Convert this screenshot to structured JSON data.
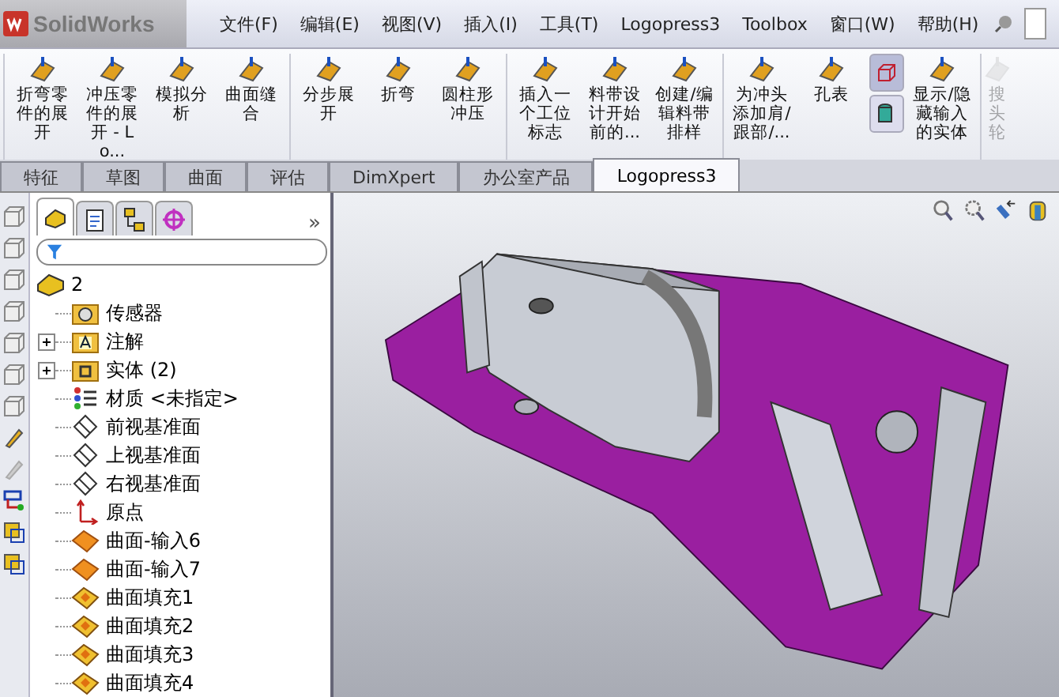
{
  "app": {
    "logo": "SolidWorks"
  },
  "menu": [
    "文件(F)",
    "编辑(E)",
    "视图(V)",
    "插入(I)",
    "工具(T)",
    "Logopress3",
    "Toolbox",
    "窗口(W)",
    "帮助(H)"
  ],
  "ribbon_groups": [
    [
      {
        "kind": "tool",
        "label": "折弯零件的展开",
        "disabled": false
      },
      {
        "kind": "tool",
        "label": "冲压零件的展开 - Lo...",
        "disabled": false
      },
      {
        "kind": "tool",
        "label": "模拟分析",
        "disabled": false
      },
      {
        "kind": "tool",
        "label": "曲面缝合",
        "disabled": false
      }
    ],
    [
      {
        "kind": "tool",
        "label": "分步展开",
        "disabled": false
      },
      {
        "kind": "tool",
        "label": "折弯",
        "disabled": false
      },
      {
        "kind": "tool",
        "label": "圆柱形冲压",
        "disabled": false
      }
    ],
    [
      {
        "kind": "tool",
        "label": "插入一个工位标志",
        "disabled": false
      },
      {
        "kind": "tool",
        "label": "料带设计开始前的...",
        "disabled": false
      },
      {
        "kind": "tool",
        "label": "创建/编辑料带排样",
        "disabled": false
      }
    ],
    [
      {
        "kind": "tool",
        "label": "为冲头添加肩/跟部/...",
        "disabled": false
      },
      {
        "kind": "tool",
        "label": "孔表",
        "disabled": false
      },
      {
        "kind": "stack"
      },
      {
        "kind": "tool",
        "label": "显示/隐藏输入的实体",
        "disabled": false
      }
    ],
    [
      {
        "kind": "tool",
        "label": "搜头轮",
        "disabled": true
      }
    ]
  ],
  "tabs": [
    {
      "label": "特征",
      "selected": false
    },
    {
      "label": "草图",
      "selected": false
    },
    {
      "label": "曲面",
      "selected": false
    },
    {
      "label": "评估",
      "selected": false
    },
    {
      "label": "DimXpert",
      "selected": false
    },
    {
      "label": "办公室产品",
      "selected": false
    },
    {
      "label": "Logopress3",
      "selected": true
    }
  ],
  "panel_tabs": [
    {
      "kind": "feature",
      "selected": true
    },
    {
      "kind": "property",
      "selected": false
    },
    {
      "kind": "config",
      "selected": false
    },
    {
      "kind": "target",
      "selected": false
    }
  ],
  "panel_more": "»",
  "tree": {
    "label": "2",
    "kind": "part",
    "children": [
      {
        "label": "传感器",
        "kind": "sensor"
      },
      {
        "label": "注解",
        "kind": "annotation",
        "expanded": false
      },
      {
        "label": "实体 (2)",
        "kind": "body",
        "expanded": false
      },
      {
        "label": "材质 <未指定>",
        "kind": "material"
      },
      {
        "label": "前视基准面",
        "kind": "plane"
      },
      {
        "label": "上视基准面",
        "kind": "plane"
      },
      {
        "label": "右视基准面",
        "kind": "plane"
      },
      {
        "label": "原点",
        "kind": "origin"
      },
      {
        "label": "曲面-输入6",
        "kind": "import"
      },
      {
        "label": "曲面-输入7",
        "kind": "import"
      },
      {
        "label": "曲面填充1",
        "kind": "fill"
      },
      {
        "label": "曲面填充2",
        "kind": "fill"
      },
      {
        "label": "曲面填充3",
        "kind": "fill"
      },
      {
        "label": "曲面填充4",
        "kind": "fill"
      }
    ]
  }
}
